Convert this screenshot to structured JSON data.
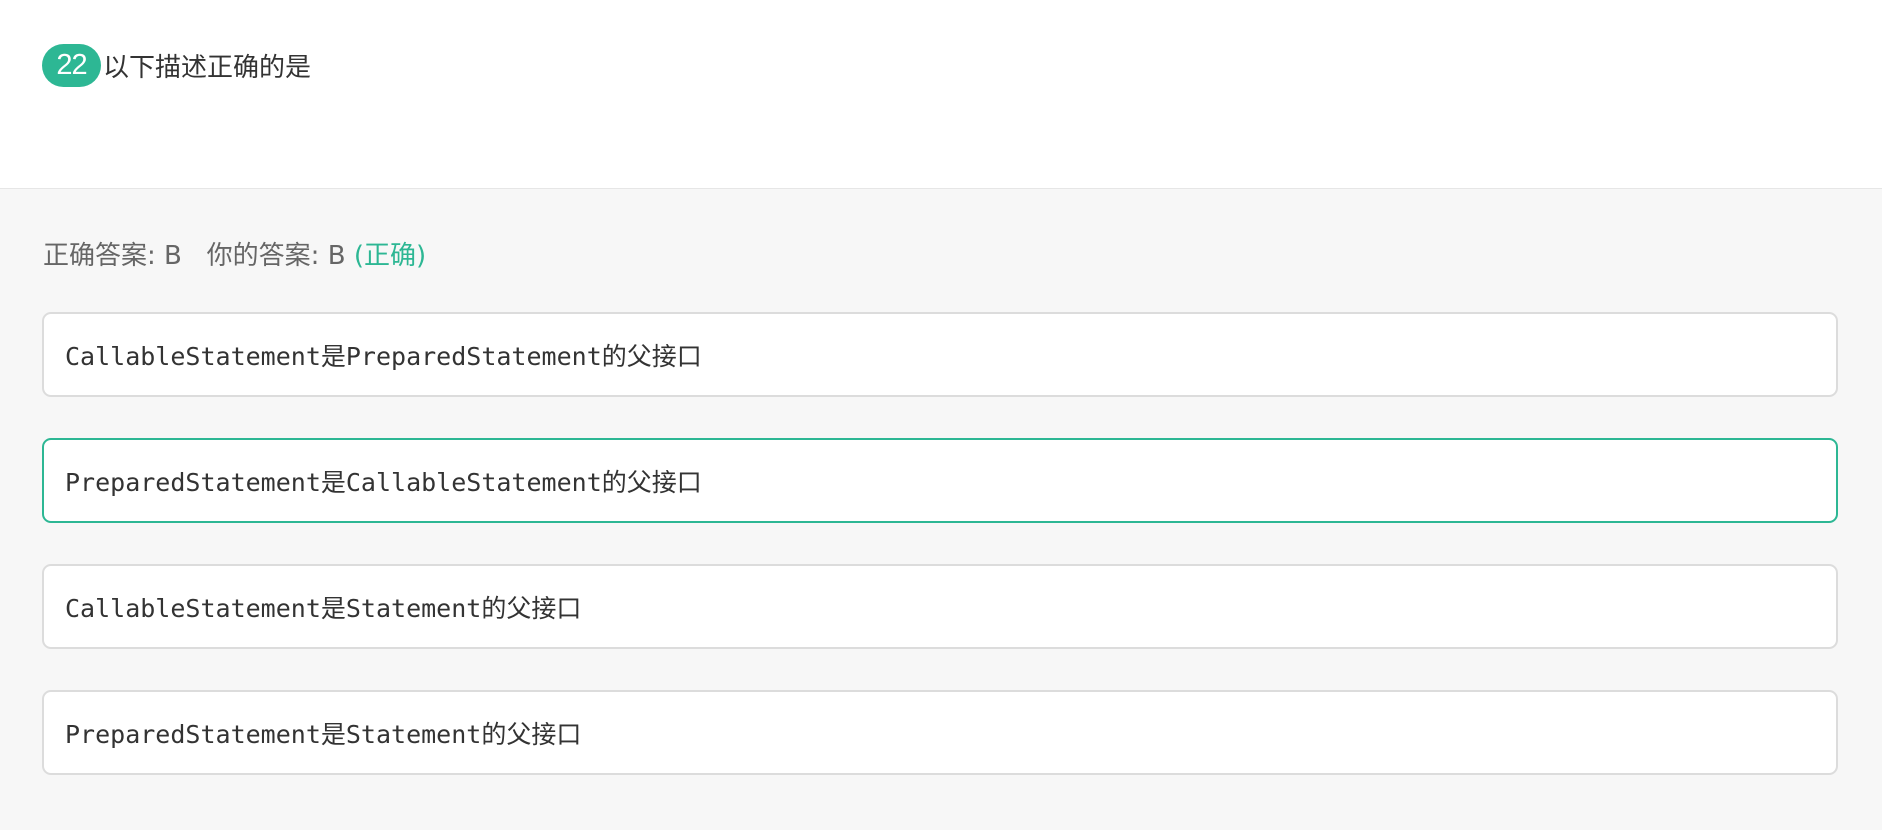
{
  "question": {
    "number": "22",
    "text": "以下描述正确的是"
  },
  "result": {
    "correct_label": "正确答案:",
    "correct_value": "B",
    "your_label": "你的答案:",
    "your_value": "B",
    "status": "(正确)",
    "status_color": "#2db794"
  },
  "options": [
    {
      "text": "CallableStatement是PreparedStatement的父接口",
      "selected": false
    },
    {
      "text": "PreparedStatement是CallableStatement的父接口",
      "selected": true
    },
    {
      "text": "CallableStatement是Statement的父接口",
      "selected": false
    },
    {
      "text": "PreparedStatement是Statement的父接口",
      "selected": false
    }
  ],
  "colors": {
    "accent": "#2db794",
    "answer_background": "#f7f7f7",
    "option_border": "#dcdcdc"
  }
}
